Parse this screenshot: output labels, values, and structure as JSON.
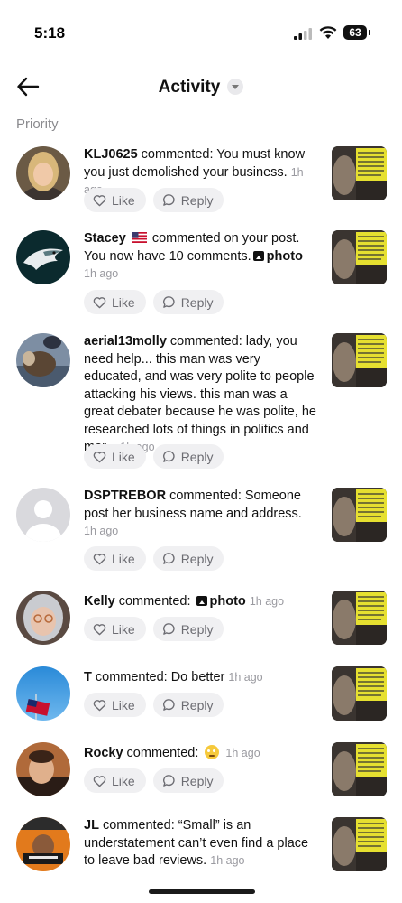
{
  "status_bar": {
    "time": "5:18",
    "battery": "63"
  },
  "header": {
    "title": "Activity"
  },
  "section": {
    "label": "Priority"
  },
  "actions": {
    "like": "Like",
    "reply": "Reply"
  },
  "items": [
    {
      "user": "KLJ0625",
      "text": " commented: You must know you just demolished your business.",
      "time": "1h ago"
    },
    {
      "user": "Stacey",
      "text_a": " commented on your post. You now have 10 comments.",
      "photo": "photo",
      "time": "1h ago"
    },
    {
      "user": "aerial13molly",
      "text": " commented: lady, you need help... this man was very educated, and was very polite to people attacking his views. this man was a great debater because he was polite, he researched lots of things in politics and mor...",
      "time": "1h ago"
    },
    {
      "user": "DSPTREBOR",
      "text": " commented: Someone post her business name and address.",
      "time": "1h ago"
    },
    {
      "user": "Kelly",
      "text": " commented:",
      "photo": "photo",
      "time": "1h ago"
    },
    {
      "user": "T",
      "text": " commented: Do better",
      "time": "1h ago"
    },
    {
      "user": "Rocky",
      "text": " commented:",
      "time": "1h ago"
    },
    {
      "user": "JL",
      "text": " commented: “Small” is an understatement can’t even find a place to leave bad reviews.",
      "time": "1h ago"
    }
  ],
  "icons": {
    "back": "arrow-left-icon",
    "like": "heart-icon",
    "reply": "speech-bubble-icon",
    "photo": "image-icon",
    "flag": "us-flag-icon",
    "emoji": "rolling-eyes-emoji-icon"
  }
}
